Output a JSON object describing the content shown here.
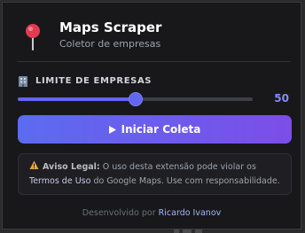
{
  "header": {
    "icon": "pushpin-icon",
    "title": "Maps Scraper",
    "subtitle": "Coletor de empresas"
  },
  "limit": {
    "icon": "building-icon",
    "label": "LIMITE DE EMPRESAS",
    "value": "50",
    "slider_fraction": 0.5
  },
  "start_button": {
    "icon": "play-icon",
    "label": "Iniciar Coleta"
  },
  "warning": {
    "icon": "warning-icon",
    "title": "Aviso Legal:",
    "text_before": "O uso desta extensão pode violar os",
    "link": "Termos de Uso",
    "text_after": "do Google Maps. Use com responsabilidade."
  },
  "footer": {
    "prefix": "Desenvolvido por",
    "author": "Ricardo Ivanov"
  },
  "colors": {
    "accent": "#6366f1",
    "accent_gradient_end": "#7c4dea",
    "background": "#18181b",
    "value_text": "#818cf8"
  }
}
